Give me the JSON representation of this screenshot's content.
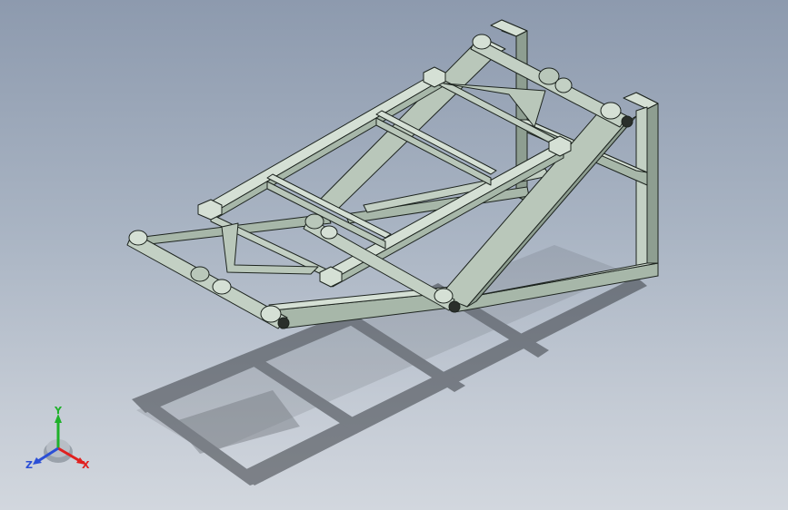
{
  "viewport": {
    "background_top": "#8d9aae",
    "background_bottom": "#d2d7de"
  },
  "model": {
    "part_color": "#b9c7ba",
    "part_dark": "#8e9e91",
    "part_light": "#d5e0d5",
    "edge_color": "#1d241f",
    "shadow_color": "#3a3e44"
  },
  "triad": {
    "x_label": "X",
    "y_label": "Y",
    "z_label": "Z",
    "x_color": "#e0201f",
    "y_color": "#1fb12a",
    "z_color": "#2b4fd6"
  }
}
